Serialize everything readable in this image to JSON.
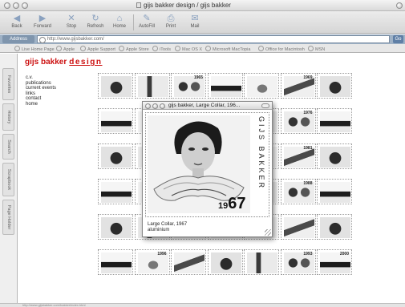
{
  "window": {
    "title": "gijs bakker design / gijs bakker"
  },
  "toolbar": {
    "buttons": [
      {
        "label": "Back",
        "icon": "back-arrow-icon"
      },
      {
        "label": "Forward",
        "icon": "forward-arrow-icon"
      },
      {
        "label": "Stop",
        "icon": "stop-icon"
      },
      {
        "label": "Refresh",
        "icon": "refresh-icon"
      },
      {
        "label": "Home",
        "icon": "home-icon"
      },
      {
        "label": "AutoFill",
        "icon": "autofill-icon"
      },
      {
        "label": "Print",
        "icon": "print-icon"
      },
      {
        "label": "Mail",
        "icon": "mail-icon"
      }
    ]
  },
  "address": {
    "label": "Address",
    "url": "http://www.gijsbakker.com/",
    "go_label": "Go"
  },
  "favorites": [
    "Live Home Page",
    "Apple",
    "Apple Support",
    "Apple Store",
    "iTools",
    "Mac OS X",
    "Microsoft MacTopia",
    "Office for Macintosh",
    "MSN"
  ],
  "side_tabs": [
    "Favorites",
    "History",
    "Search",
    "Scrapbook",
    "Page Holder"
  ],
  "status": {
    "text": "http://www.gijsbakker.com/bakker/index.html"
  },
  "page": {
    "logo_a": "gijs bakker",
    "logo_b": "design",
    "nav": [
      "c.v.",
      "publications",
      "current events",
      "links",
      "contact",
      "home"
    ]
  },
  "grid_years": {
    "r0c2": "1965",
    "r0c5": "1969",
    "r1c5": "1976",
    "r2c5": "1981",
    "r3c5": "1988",
    "r5c1": "1996",
    "r5c5": "1993",
    "r5c6": "2000"
  },
  "popup": {
    "title": "gijs bakker, Large Collar, 196...",
    "stamp_name": "GIJS BAKKER",
    "year_prefix": "19",
    "year_suffix": "67",
    "caption_line1": "Large Collar, 1967",
    "caption_line2": "aluminium"
  },
  "colors": {
    "logo_red": "#cc1111",
    "address_bar": "#9fb2c6",
    "go_button": "#5f7fa6"
  }
}
